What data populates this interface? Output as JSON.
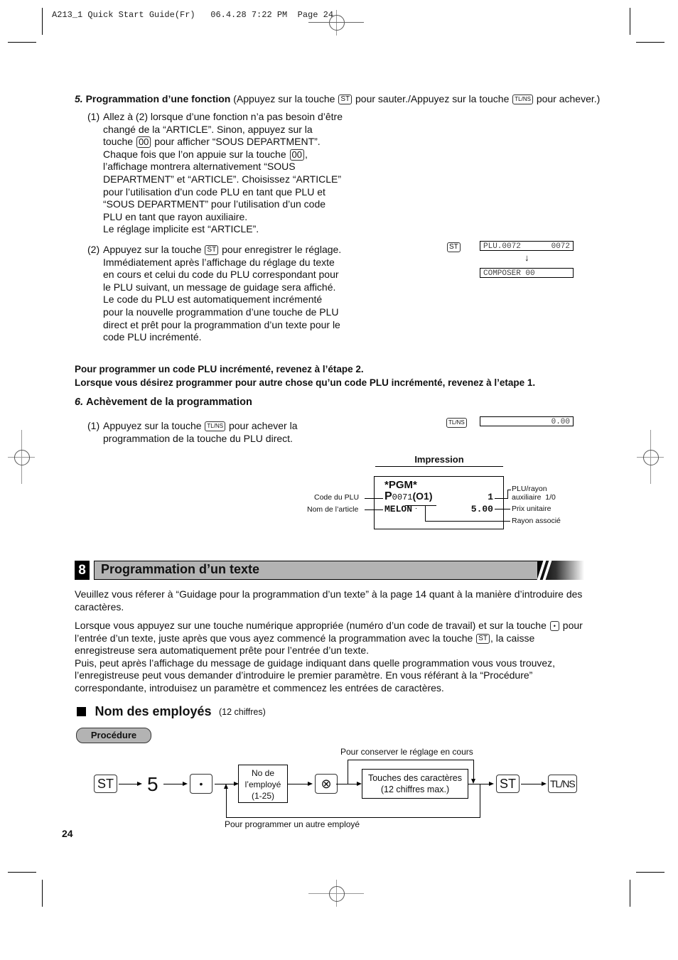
{
  "header": {
    "slug": "A213_1 Quick Start Guide(Fr)   06.4.28 7:22 PM  Page 24"
  },
  "keys": {
    "st": "ST",
    "tlns": "TL/NS",
    "double_zero": "00",
    "dot": "•",
    "five": "5",
    "multiply": "⊗"
  },
  "step5": {
    "number": "5.",
    "title": "Programmation d’une fonction",
    "note_a": "(Appuyez sur la touche",
    "note_b": "pour sauter./Appuyez sur la touche",
    "note_c": "pour achever.)",
    "item1": {
      "num": "(1)",
      "text_a": "Allez à (2) lorsque d’une fonction n’a pas besoin d’être changé de la “ARTICLE”. Sinon, appuyez sur la touche",
      "text_b": "pour afficher “SOUS DEPARTMENT”. Chaque fois que l’on appuie sur la touche",
      "text_c": ", l’affichage montrera alternativement “SOUS DEPARTMENT” et “ARTICLE”. Choisissez “ARTICLE” pour l’utilisation d’un code PLU en tant que PLU et “SOUS DEPARTMENT” pour l’utilisation d’un code PLU en tant que rayon auxiliaire.",
      "text_d": "Le réglage implicite est “ARTICLE”."
    },
    "item2": {
      "num": "(2)",
      "text_a": "Appuyez sur la touche",
      "text_b": "pour enregistrer le réglage. Immédiatement après l’affichage du réglage du texte en cours et celui du code du PLU correspondant pour le PLU suivant, un message de guidage sera affiché. Le code du PLU est automatiquement incrémenté pour la nouvelle programmation d’une touche de PLU direct et prêt pour la programmation d’un texte pour le code PLU incrémenté."
    },
    "display1": {
      "left": "PLU.0072",
      "right": "0072"
    },
    "arrow": "↓",
    "display2": "COMPOSER 00"
  },
  "notes": {
    "line1": "Pour programmer un code PLU incrémenté, revenez à l’étape 2.",
    "line2": "Lorsque vous désirez programmer pour autre chose qu’un code PLU incrémenté, revenez à l’etape 1."
  },
  "step6": {
    "number": "6.",
    "title": "Achèvement de la programmation",
    "item1": {
      "num": "(1)",
      "text_a": "Appuyez sur la touche",
      "text_b": "pour achever la programmation de la touche du PLU direct."
    },
    "display": "0.00"
  },
  "receipt": {
    "heading": "Impression",
    "line1": "*PGM*",
    "code_prefix": "P",
    "code": "0071",
    "dept": "(O1)",
    "qty": "1",
    "name": "MELON",
    "price": "5.00",
    "labels": {
      "code": "Code du PLU",
      "name": "Nom de l’article",
      "plu_rayon": "PLU/rayon",
      "aux": "auxiliaire  1/0",
      "price": "Prix unitaire",
      "dept": "Rayon associé"
    }
  },
  "section8": {
    "number": "8",
    "title": "Programmation d’un texte",
    "para1": "Veuillez vous réferer à “Guidage pour la programmation d’un texte” à la page 14 quant à la manière d’introduire des caractères.",
    "para2_a": "Lorsque vous appuyez sur une touche numérique appropriée (numéro d’un code de travail) et sur la touche",
    "para2_b": "pour l’entrée d’un texte, juste après que vous ayez commencé la programmation avec la touche",
    "para2_c": ", la caisse enregistreuse sera automatiquement prête pour l’entrée d’un texte.",
    "para3": "Puis, peut après l’affichage du message de guidage indiquant dans quelle programmation vous vous trouvez, l’enregistreuse peut vous demander d’introduire le premier paramètre.  En vous référant à la “Procédure” correspondante, introduisez un paramètre et commencez les entrées de caractères."
  },
  "employees": {
    "title": "Nom des employés",
    "subtitle": "(12 chiffres)",
    "badge": "Procédure",
    "flow": {
      "box1": [
        "No de",
        "l’employé",
        "(1-25)"
      ],
      "box2": [
        "Touches des caractères",
        "(12 chiffres max.)"
      ],
      "keep_label": "Pour conserver le réglage en cours",
      "loop_label": "Pour programmer un autre employé"
    }
  },
  "page_number": "24"
}
